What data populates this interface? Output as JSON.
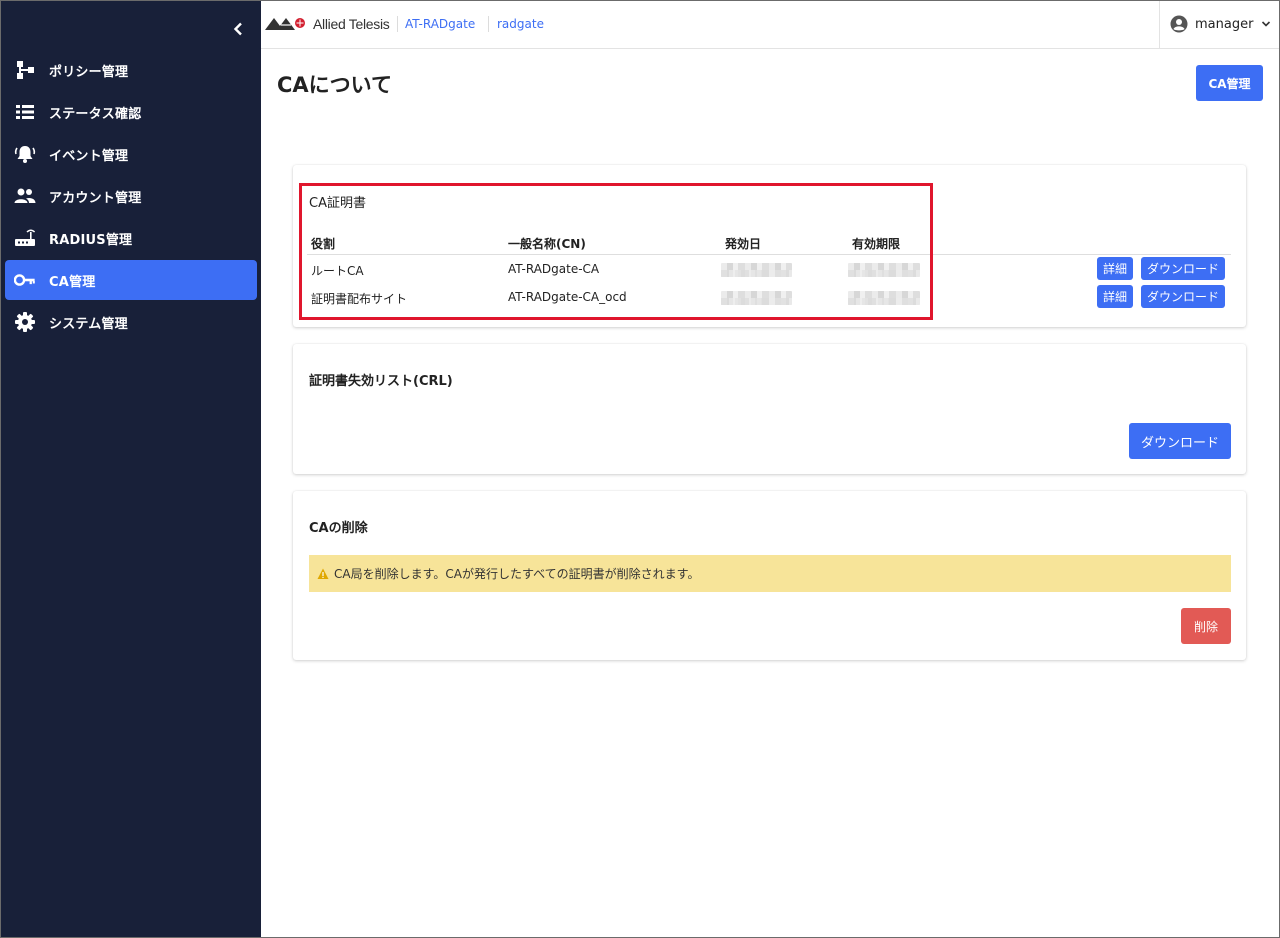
{
  "app": {
    "brand": "Allied Telesis",
    "product_link": "AT-RADgate",
    "host_link": "radgate",
    "user": "manager"
  },
  "sidebar": {
    "items": [
      {
        "label": "ポリシー管理",
        "icon": "policy-tree-icon",
        "active": false
      },
      {
        "label": "ステータス確認",
        "icon": "list-icon",
        "active": false
      },
      {
        "label": "イベント管理",
        "icon": "bell-icon",
        "active": false
      },
      {
        "label": "アカウント管理",
        "icon": "users-icon",
        "active": false
      },
      {
        "label": "RADIUS管理",
        "icon": "router-icon",
        "active": false
      },
      {
        "label": "CA管理",
        "icon": "key-icon",
        "active": true
      },
      {
        "label": "システム管理",
        "icon": "gear-icon",
        "active": false
      }
    ]
  },
  "main": {
    "title": "CAについて",
    "ca_manage_button": "CA管理",
    "certificates": {
      "title": "CA証明書",
      "headers": [
        "役割",
        "一般名称(CN)",
        "発効日",
        "有効期限"
      ],
      "rows": [
        {
          "role": "ルートCA",
          "cn": "AT-RADgate-CA"
        },
        {
          "role": "証明書配布サイト",
          "cn": "AT-RADgate-CA_ocd"
        }
      ],
      "detail_button": "詳細",
      "download_button": "ダウンロード"
    },
    "crl": {
      "title": "証明書失効リスト(CRL)",
      "download_button": "ダウンロード"
    },
    "delete_ca": {
      "title": "CAの削除",
      "warning": "CA局を削除します。CAが発行したすべての証明書が削除されます。",
      "delete_button": "削除"
    }
  },
  "colors": {
    "sidebar_bg": "#182039",
    "accent": "#3d6ef4",
    "danger": "#e25a55",
    "warning_bg": "#f7e499",
    "highlight": "#e0162d"
  }
}
